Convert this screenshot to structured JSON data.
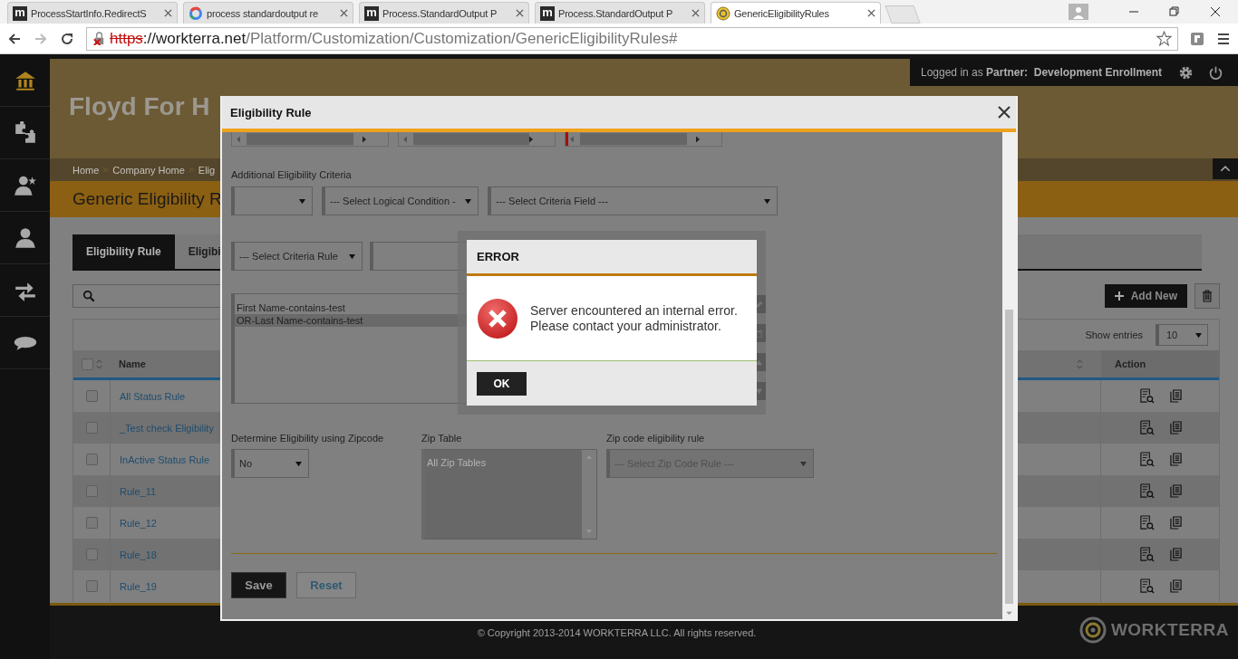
{
  "browser": {
    "tabs": [
      {
        "title": "ProcessStartInfo.RedirectS",
        "favicon": {
          "kind": "letter",
          "text": "m"
        },
        "selected": false
      },
      {
        "title": "process standardoutput re",
        "favicon": {
          "kind": "google"
        },
        "selected": false
      },
      {
        "title": "Process.StandardOutput P",
        "favicon": {
          "kind": "letter",
          "text": "m"
        },
        "selected": false
      },
      {
        "title": "Process.StandardOutput P",
        "favicon": {
          "kind": "letter",
          "text": "m"
        },
        "selected": false
      },
      {
        "title": "GenericEligibilityRules",
        "favicon": {
          "kind": "site"
        },
        "selected": true
      }
    ],
    "address": {
      "insecure": true,
      "scheme": "https",
      "host": "://workterra.net",
      "path": "/Platform/Customization/Customization/GenericEligibilityRules#"
    }
  },
  "user_bar": {
    "prefix": "Logged in as",
    "role": "Partner:",
    "name": "Development Enrollment"
  },
  "sidebar": [
    {
      "kind": "home",
      "selected": true
    },
    {
      "kind": "puzzle",
      "selected": false
    },
    {
      "kind": "user-star",
      "selected": false
    },
    {
      "kind": "user",
      "selected": false
    },
    {
      "kind": "transfer",
      "selected": false
    },
    {
      "kind": "chat",
      "selected": false
    }
  ],
  "header": {
    "company": "Floyd For H"
  },
  "breadcrumbs": [
    "Home",
    "Company Home",
    "Elig"
  ],
  "page_title": "Generic Eligibility R",
  "tabs": [
    {
      "label": "Eligibility Rule",
      "selected": true
    },
    {
      "label": "Eligibi",
      "selected": false
    }
  ],
  "toolbar": {
    "add_button": "Add New",
    "show_entries_label": "Show entries",
    "show_entries_value": "10"
  },
  "table": {
    "columns": [
      "Name",
      "Action"
    ],
    "select_all_checked": false,
    "rows": [
      {
        "name": "All Status Rule",
        "checked": false
      },
      {
        "name": "_Test check Eligibility",
        "checked": false
      },
      {
        "name": "InActive Status Rule",
        "checked": false
      },
      {
        "name": "Rule_11",
        "checked": false
      },
      {
        "name": "Rule_12",
        "checked": false
      },
      {
        "name": "Rule_18",
        "checked": false
      },
      {
        "name": "Rule_19",
        "checked": false
      }
    ]
  },
  "footer": {
    "copyright": "© Copyright 2013-2014 WORKTERRA LLC. All rights reserved.",
    "logo": "WORKTERRA"
  },
  "modal": {
    "title": "Eligibility Rule",
    "section_label": "Additional Eligibility Criteria",
    "logical_condition": "--- Select Logical Condition -",
    "criteria_field": "--- Select Criteria Field ---",
    "criteria_rule": "--- Select Criteria Rule",
    "criteria_list": [
      {
        "text": "First Name-contains-test",
        "selected": false
      },
      {
        "text": "OR-Last Name-contains-test",
        "selected": true
      }
    ],
    "zip": {
      "label": "Determine Eligibility using Zipcode",
      "value": "No",
      "table_label": "Zip Table",
      "table_items": [
        "All Zip Tables"
      ],
      "table_disabled": true,
      "rule_label": "Zip code eligibility rule",
      "rule_value": "--- Select Zip Code Rule ---",
      "rule_disabled": true
    },
    "buttons": [
      {
        "label": "Save",
        "kind": "primary"
      },
      {
        "label": "Reset",
        "kind": "secondary"
      }
    ]
  },
  "error_dialog": {
    "title": "ERROR",
    "message": "Server encountered an internal error. Please contact your administrator.",
    "button": "OK"
  }
}
